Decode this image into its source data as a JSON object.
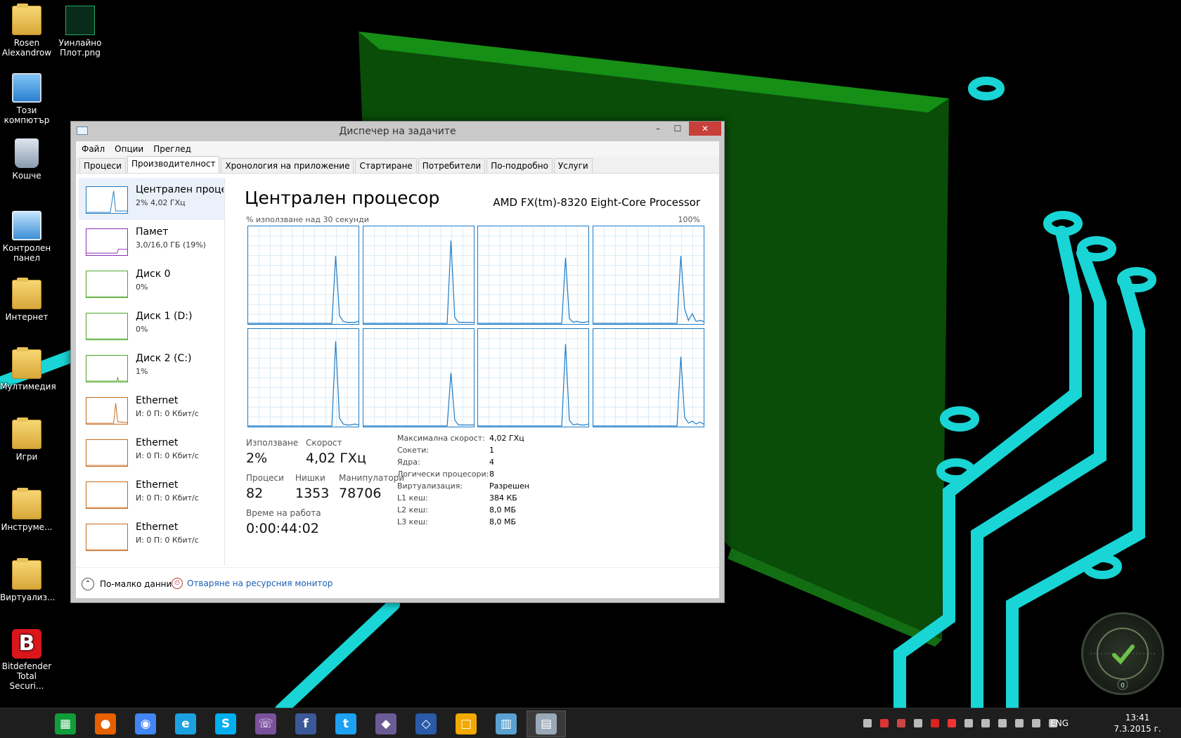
{
  "desktop": {
    "icons": [
      {
        "label": "Rosen\nAlexandrow",
        "icon": "user-folder-icon"
      },
      {
        "label": "Уинлайно\nПлот.png",
        "icon": "image-file-icon"
      },
      {
        "label": "Този\nкомпютър",
        "icon": "computer-icon"
      },
      {
        "label": "Кошче",
        "icon": "recycle-bin-icon"
      },
      {
        "label": "Контролен\nпанел",
        "icon": "control-panel-icon"
      },
      {
        "label": "Интернет",
        "icon": "folder-icon"
      },
      {
        "label": "Мултимедия",
        "icon": "folder-icon"
      },
      {
        "label": "Игри",
        "icon": "folder-icon"
      },
      {
        "label": "Инструме...",
        "icon": "folder-icon"
      },
      {
        "label": "Виртуализ...",
        "icon": "folder-icon"
      },
      {
        "label": "Bitdefender\nTotal Securi...",
        "icon": "bitdefender-icon"
      }
    ]
  },
  "window": {
    "title": "Диспечер на задачите",
    "controls": {
      "minimize": "–",
      "maximize": "☐",
      "close": "✕"
    },
    "menu": [
      "Файл",
      "Опции",
      "Преглед"
    ],
    "tabs": [
      "Процеси",
      "Производителност",
      "Хронология на приложение",
      "Стартиране",
      "Потребители",
      "По-подробно",
      "Услуги"
    ],
    "active_tab": "Производителност"
  },
  "sidebar": {
    "items": [
      {
        "name": "Централен процесор",
        "value": "2% 4,02 ГХц",
        "color": "#1d7cc7"
      },
      {
        "name": "Памет",
        "value": "3,0/16,0 ГБ (19%)",
        "color": "#8b2fb5"
      },
      {
        "name": "Диск 0",
        "value": "0%",
        "color": "#4da72a"
      },
      {
        "name": "Диск 1 (D:)",
        "value": "0%",
        "color": "#4da72a"
      },
      {
        "name": "Диск 2 (C:)",
        "value": "1%",
        "color": "#4da72a"
      },
      {
        "name": "Ethernet",
        "value": "И: 0 П: 0 Кбит/с",
        "color": "#c56a1c"
      },
      {
        "name": "Ethernet",
        "value": "И: 0 П: 0 Кбит/с",
        "color": "#c56a1c"
      },
      {
        "name": "Ethernet",
        "value": "И: 0 П: 0 Кбит/с",
        "color": "#c56a1c"
      },
      {
        "name": "Ethernet",
        "value": "И: 0 П: 0 Кбит/с",
        "color": "#c56a1c"
      }
    ]
  },
  "main": {
    "title": "Централен процесор",
    "model": "AMD FX(tm)-8320 Eight-Core Processor",
    "chart_caption": "% използване над 30 секунди",
    "chart_max": "100%",
    "stats": {
      "usage_label": "Използване",
      "usage": "2%",
      "speed_label": "Скорост",
      "speed": "4,02 ГХц",
      "processes_label": "Процеси",
      "processes": "82",
      "threads_label": "Нишки",
      "threads": "1353",
      "handles_label": "Манипулатори",
      "handles": "78706",
      "uptime_label": "Време на работа",
      "uptime": "0:00:44:02"
    },
    "specs": [
      {
        "label": "Максимална скорост:",
        "value": "4,02 ГХц"
      },
      {
        "label": "Сокети:",
        "value": "1"
      },
      {
        "label": "Ядра:",
        "value": "4"
      },
      {
        "label": "Логически процесори:",
        "value": "8"
      },
      {
        "label": "Виртуализация:",
        "value": "Разрешен"
      },
      {
        "label": "L1 кеш:",
        "value": "384 КБ"
      },
      {
        "label": "L2 кеш:",
        "value": "8,0 МБ"
      },
      {
        "label": "L3 кеш:",
        "value": "8,0 МБ"
      }
    ]
  },
  "chart_data": {
    "type": "line",
    "title": "",
    "xlabel": "",
    "ylabel": "% използване над 30 секунди",
    "ylim": [
      0,
      100
    ],
    "x": [
      0,
      1,
      2,
      3,
      4,
      5,
      6,
      7,
      8,
      9,
      10,
      11,
      12,
      13,
      14,
      15,
      16,
      17,
      18,
      19,
      20,
      21,
      22,
      23,
      24,
      25,
      26,
      27,
      28,
      29
    ],
    "series": [
      {
        "values": [
          0,
          0,
          0,
          0,
          0,
          0,
          0,
          0,
          0,
          0,
          0,
          0,
          0,
          0,
          0,
          0,
          0,
          0,
          0,
          0,
          0,
          0,
          0,
          70,
          8,
          2,
          1,
          1,
          1,
          2
        ]
      },
      {
        "values": [
          0,
          0,
          0,
          0,
          0,
          0,
          0,
          0,
          0,
          0,
          0,
          0,
          0,
          0,
          0,
          0,
          0,
          0,
          0,
          0,
          0,
          0,
          0,
          86,
          6,
          1,
          1,
          1,
          1,
          1
        ]
      },
      {
        "values": [
          0,
          0,
          0,
          0,
          0,
          0,
          0,
          0,
          0,
          0,
          0,
          0,
          0,
          0,
          0,
          0,
          0,
          0,
          0,
          0,
          0,
          0,
          0,
          68,
          5,
          1,
          2,
          1,
          1,
          2
        ]
      },
      {
        "values": [
          0,
          0,
          0,
          0,
          0,
          0,
          0,
          0,
          0,
          0,
          0,
          0,
          0,
          0,
          0,
          0,
          0,
          0,
          0,
          0,
          0,
          0,
          0,
          70,
          15,
          3,
          10,
          2,
          3,
          2
        ]
      },
      {
        "values": [
          0,
          0,
          0,
          0,
          0,
          0,
          0,
          0,
          0,
          0,
          0,
          0,
          0,
          0,
          0,
          0,
          0,
          0,
          0,
          0,
          0,
          0,
          0,
          88,
          8,
          2,
          1,
          1,
          2,
          1
        ]
      },
      {
        "values": [
          0,
          0,
          0,
          0,
          0,
          0,
          0,
          0,
          0,
          0,
          0,
          0,
          0,
          0,
          0,
          0,
          0,
          0,
          0,
          0,
          0,
          0,
          0,
          55,
          6,
          1,
          1,
          1,
          1,
          1
        ]
      },
      {
        "values": [
          0,
          0,
          0,
          0,
          0,
          0,
          0,
          0,
          0,
          0,
          0,
          0,
          0,
          0,
          0,
          0,
          0,
          0,
          0,
          0,
          0,
          0,
          0,
          85,
          6,
          1,
          2,
          1,
          1,
          2
        ]
      },
      {
        "values": [
          0,
          0,
          0,
          0,
          0,
          0,
          0,
          0,
          0,
          0,
          0,
          0,
          0,
          0,
          0,
          0,
          0,
          0,
          0,
          0,
          0,
          0,
          0,
          72,
          9,
          3,
          5,
          2,
          4,
          2
        ]
      }
    ]
  },
  "footer": {
    "fewer_details": "По-малко данни",
    "resource_monitor": "Отваряне на ресурсния монитор"
  },
  "taskbar": {
    "apps": [
      {
        "icon": "start-icon",
        "color": "#1e1e1e"
      },
      {
        "icon": "store-icon",
        "color": "#0f9d3a"
      },
      {
        "icon": "firefox-icon",
        "color": "#e66000"
      },
      {
        "icon": "chrome-icon",
        "color": "#4285f4"
      },
      {
        "icon": "internet-explorer-icon",
        "color": "#1ba1e2"
      },
      {
        "icon": "skype-icon",
        "color": "#00aff0"
      },
      {
        "icon": "viber-icon",
        "color": "#7b519d"
      },
      {
        "icon": "facebook-icon",
        "color": "#3b5998"
      },
      {
        "icon": "twitter-icon",
        "color": "#1da1f2"
      },
      {
        "icon": "pidgin-icon",
        "color": "#6b5b95"
      },
      {
        "icon": "virtualbox-icon",
        "color": "#2a5aa8"
      },
      {
        "icon": "app-icon",
        "color": "#f2a900"
      },
      {
        "icon": "city-icon",
        "color": "#5aa0d0"
      },
      {
        "icon": "task-manager-icon",
        "color": "#9aa9b8"
      }
    ],
    "language": "ENG",
    "time": "13:41",
    "date": "7.3.2015 г."
  },
  "gadget": {
    "count": "0"
  }
}
